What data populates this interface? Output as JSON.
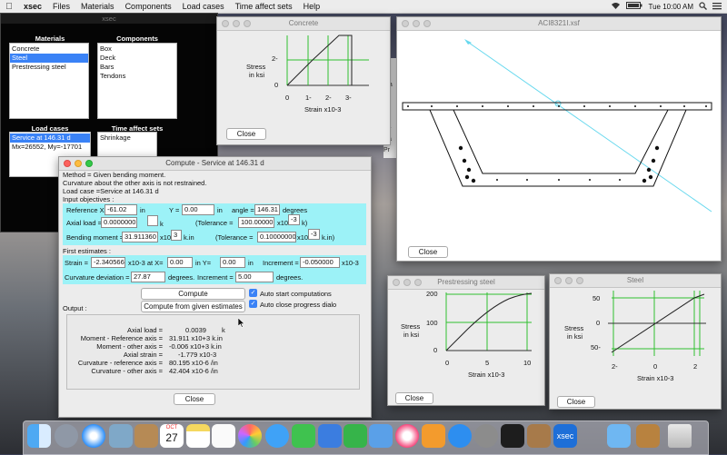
{
  "menubar": {
    "apple": "",
    "app": "xsec",
    "items": [
      "Files",
      "Materials",
      "Components",
      "Load cases",
      "Time affect sets",
      "Help"
    ],
    "time": "Tue 10:00 AM",
    "battery": "",
    "wifi": "wifi-icon",
    "search": "search-icon",
    "list": "list-icon"
  },
  "xsec_window": {
    "title": "xsec",
    "materials": {
      "header": "Materials",
      "items": [
        "Concrete",
        "Steel",
        "Prestressing steel"
      ],
      "selected": 1
    },
    "components": {
      "header": "Components",
      "items": [
        "Box",
        "Deck",
        "Bars",
        "Tendons"
      ]
    },
    "load_cases": {
      "header": "Load cases",
      "items": [
        "Service at 146.31 d",
        "Mx=26552, My=-17701"
      ],
      "selected": 0
    },
    "time_sets": {
      "header": "Time affect sets",
      "items": [
        "Shrinkage"
      ]
    },
    "partial_labels": [
      "Fi",
      "D",
      "Ma",
      "C",
      "Lo",
      "Ti",
      "Se",
      "Ca",
      "Pr"
    ]
  },
  "concrete_window": {
    "title": "Concrete",
    "ylabel": [
      "Stress",
      "in ksi"
    ],
    "xlabel": "Strain x10-3",
    "yticks": [
      "2-",
      "0"
    ],
    "xticks": [
      "0",
      "1-",
      "2-",
      "3-"
    ],
    "close": "Close"
  },
  "section_window": {
    "title": "ACI8321I.xsf",
    "close": "Close"
  },
  "compute_window": {
    "title": "Compute - Service at 146.31 d",
    "method": "Method = Given bending moment.",
    "curvature_note": "Curvature about the other axis is not restrained.",
    "load_case": "Load case =Service at 146.31 d",
    "input_objectives": "Input objectives :",
    "reference_x_label": "Reference  X",
    "reference_x": "-61.02",
    "in1": "in",
    "y_label": "Y =",
    "y_value": "0.00",
    "in2": "in",
    "angle_label": "angle =",
    "angle_value": "146.31",
    "degrees1": "degrees",
    "axial_label": "Axial load =",
    "axial_value": "0.0000000",
    "axial_unit": "k",
    "tolerance1_label": "(Tolerance =",
    "tolerance1_value": "100.00000",
    "tol1_x10": "x10",
    "tol1_exp": "-3",
    "tol1_unit": "k)",
    "bending_label": "Bending moment =",
    "bending_value": "31.911360",
    "bending_x10": "x10",
    "bending_exp": "3",
    "bending_unit": "k.in",
    "tolerance2_label": "(Tolerance =",
    "tolerance2_value": "0.10000000",
    "tol2_x10": "x10",
    "tol2_exp": "-3",
    "tol2_unit": "k.in)",
    "first_estimates": "First estimates :",
    "strain_label": "Strain =",
    "strain_value": "-2.340566",
    "strain_at": "x10-3 at X=",
    "strain_x": "0.00",
    "in3": "in Y=",
    "strain_y": "0.00",
    "in4": "in",
    "increment_label": "Increment =",
    "increment_value": "-0.050000",
    "increment_unit": "x10-3",
    "curv_dev_label": "Curvature deviation =",
    "curv_dev_value": "27.87",
    "degrees2": "degrees.",
    "curv_inc_label": "Increment =",
    "curv_inc_value": "5.00",
    "degrees3": "degrees.",
    "compute_btn": "Compute",
    "compute_given_btn": "Compute from given estimates",
    "auto_start": "Auto start computations",
    "auto_close": "Auto close progress dialog",
    "output_label": "Output :",
    "output": [
      {
        "label": "Axial load =",
        "value": "0.0039",
        "unit": "k"
      },
      {
        "label": "Moment - Reference axis =",
        "value": "31.911 x10+3 k.in",
        "unit": ""
      },
      {
        "label": "Moment - other axis =",
        "value": "-0.006 x10+3 k.in",
        "unit": ""
      },
      {
        "label": "Axial strain =",
        "value": "-1.779 x10-3",
        "unit": ""
      },
      {
        "label": "Curvature - reference axis =",
        "value": "80.195 x10-6 /in",
        "unit": ""
      },
      {
        "label": "Curvature - other axis =",
        "value": "42.404 x10-6 /in",
        "unit": ""
      }
    ],
    "close": "Close"
  },
  "prestressing_window": {
    "title": "Prestressing steel",
    "ylabel": [
      "Stress",
      "in ksi"
    ],
    "xlabel": "Strain x10-3",
    "yticks": [
      "200",
      "100",
      "0"
    ],
    "xticks": [
      "0",
      "5",
      "10"
    ],
    "close": "Close"
  },
  "steel_window": {
    "title": "Steel",
    "ylabel": [
      "Stress",
      "in ksi"
    ],
    "xlabel": "Strain x10-3",
    "yticks": [
      "50",
      "0",
      "50-"
    ],
    "xticks": [
      "2-",
      "0",
      "2"
    ],
    "close": "Close"
  },
  "dock": {
    "items": [
      "finder",
      "launchpad",
      "safari",
      "preview",
      "contacts",
      "calendar",
      "notes",
      "reminders",
      "photos",
      "messages",
      "facetime",
      "keynote",
      "numbers",
      "xcode",
      "itunes",
      "ibooks",
      "appstore",
      "system-preferences",
      "terminal",
      "xsec-app",
      "folder",
      "archive",
      "trash"
    ],
    "calendar_month": "OCT",
    "calendar_day": "27",
    "xsec_label": "xsec"
  },
  "colors": {
    "accent": "#3a82f6",
    "cyan_field": "#9cf2f7",
    "plot_green": "#30c030",
    "section_line": "#66d8ee"
  }
}
